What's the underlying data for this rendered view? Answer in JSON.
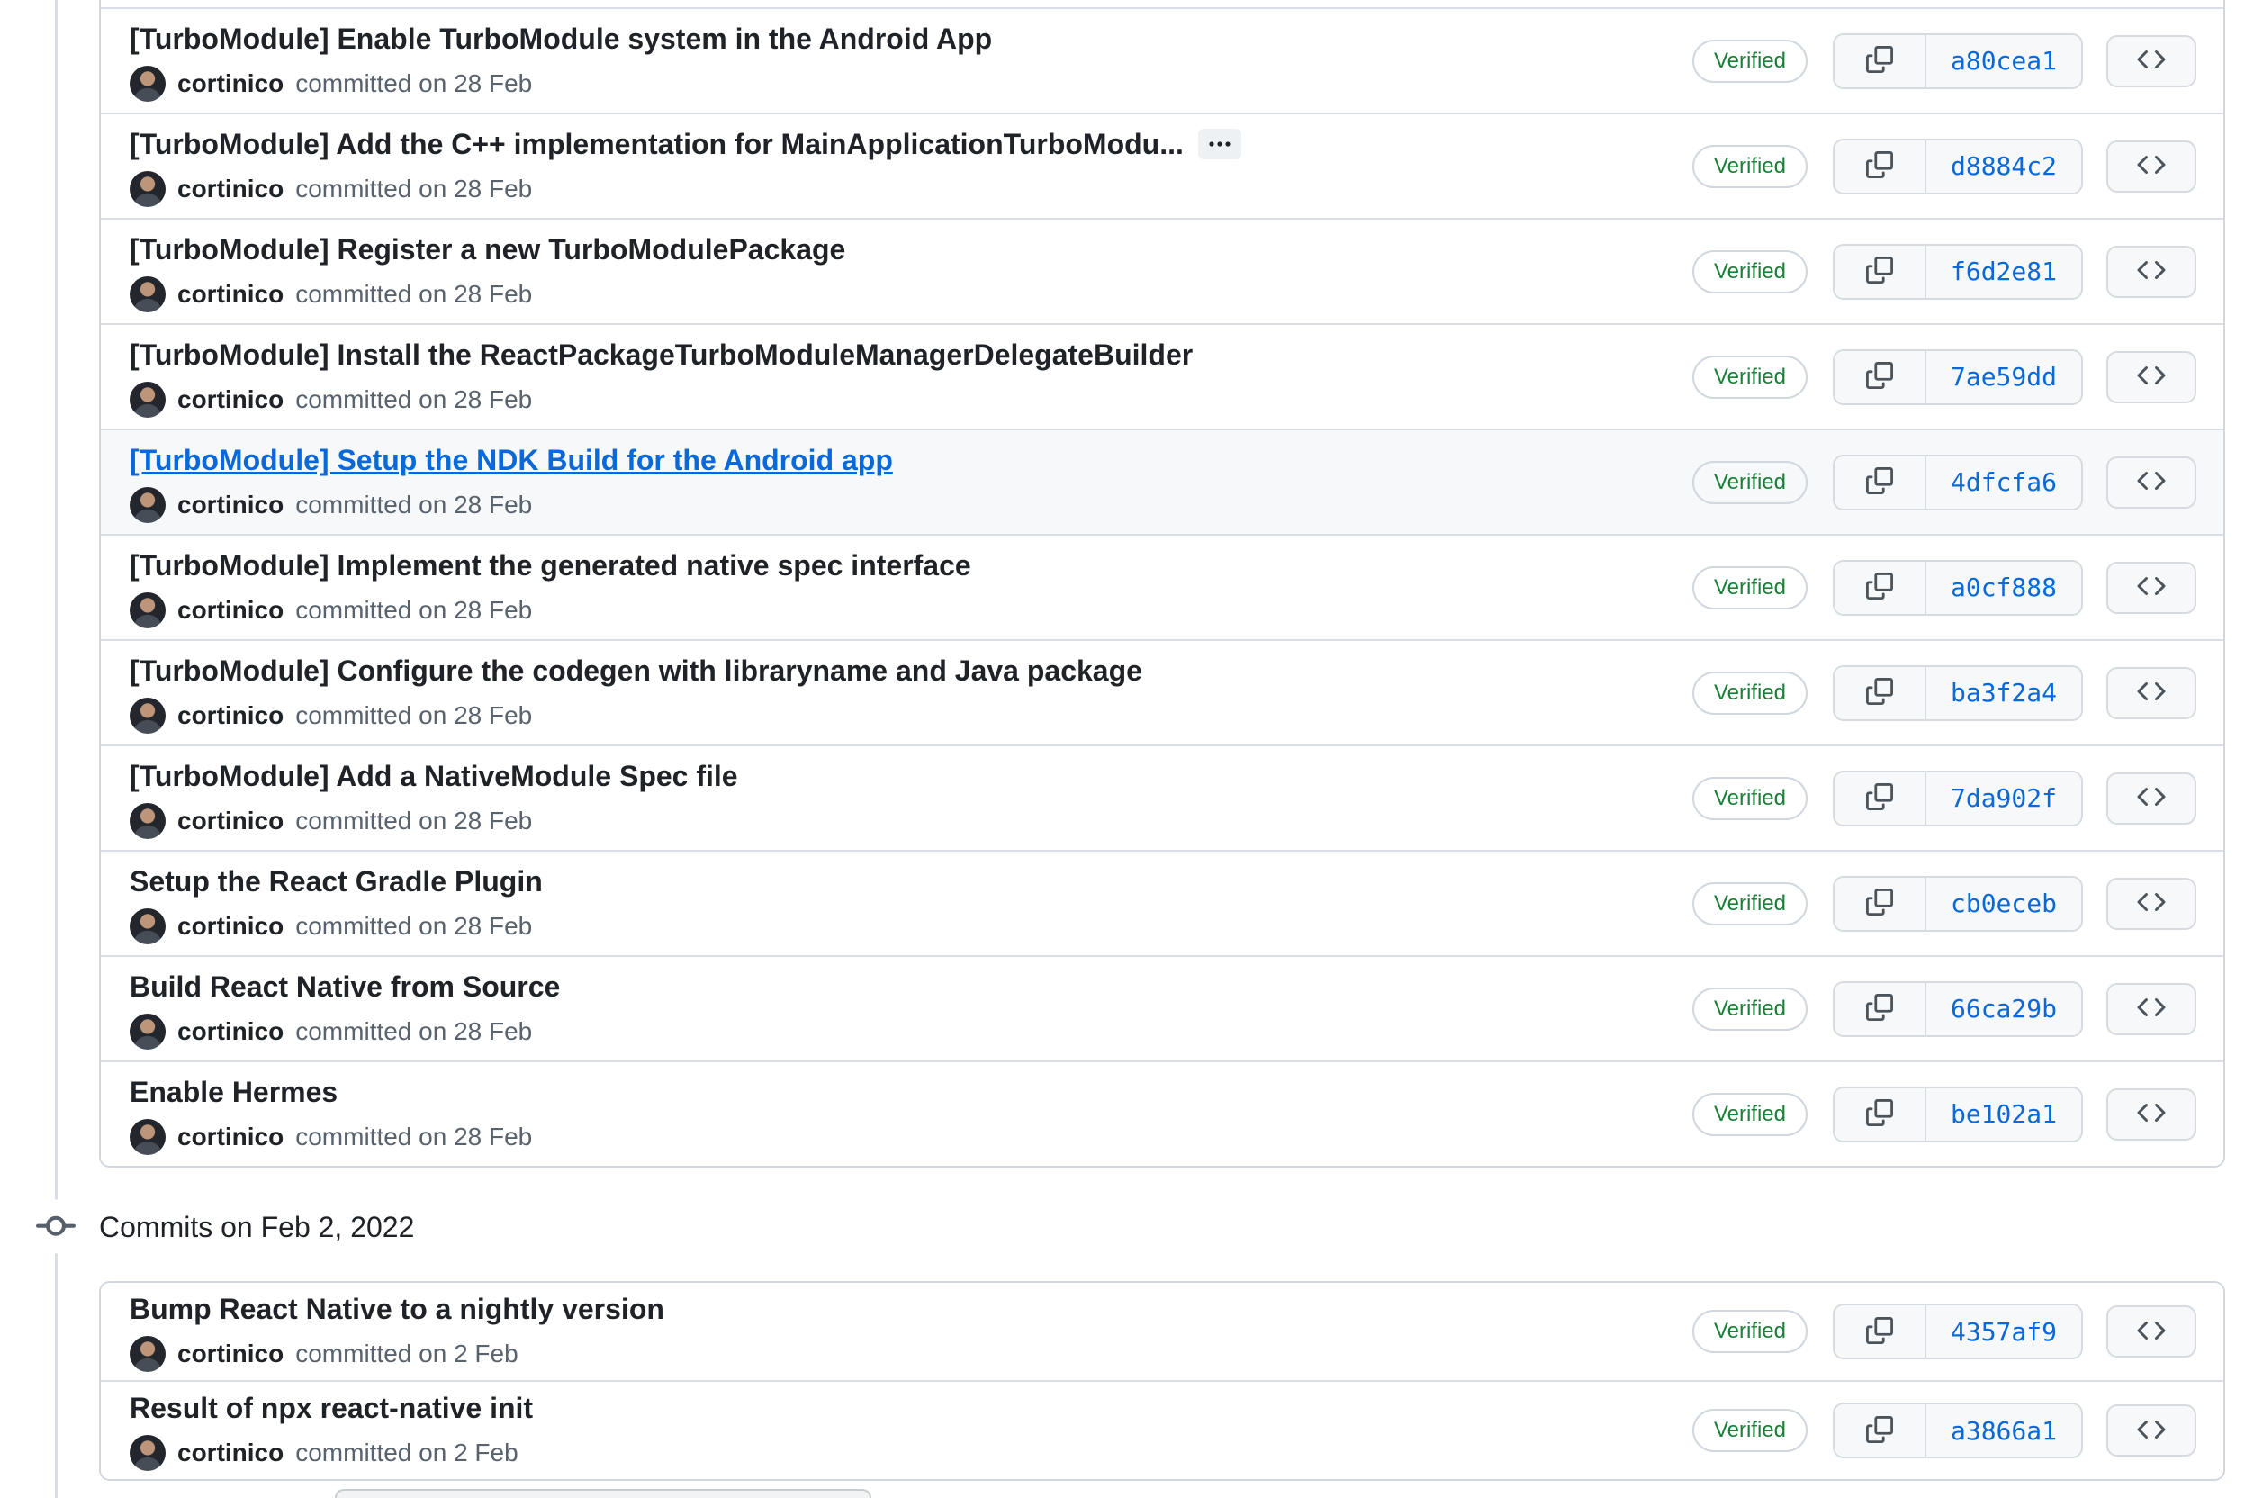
{
  "labels": {
    "verified": "Verified",
    "author": "cortinico"
  },
  "icons": {
    "copy_icon": "⧉",
    "browse_code_icon": "<>",
    "git_commit_icon": "-o-",
    "ellipsis_icon": "⋯"
  },
  "colors": {
    "title_text": "#1f2328",
    "muted_text": "#59636e",
    "link_blue": "#0969da",
    "verified_green": "#1a7f37",
    "container_border": "#d0d7de",
    "row_divider": "#d8dee4",
    "button_bg": "#f6f8fa",
    "hover_row_bg": "#f6f8fa",
    "timeline_line": "#d8dee4"
  },
  "sections": [
    {
      "date_header": null,
      "partial_top_row": true,
      "commits": [
        {
          "title": "[TurboModule] Enable TurboModule system in the Android App",
          "author": "cortinico",
          "committed": "committed on 28 Feb",
          "sha": "a80cea1"
        },
        {
          "title": "[TurboModule] Add the C++ implementation for MainApplicationTurboModu...",
          "expander": true,
          "author": "cortinico",
          "committed": "committed on 28 Feb",
          "sha": "d8884c2"
        },
        {
          "title": "[TurboModule] Register a new TurboModulePackage",
          "author": "cortinico",
          "committed": "committed on 28 Feb",
          "sha": "f6d2e81"
        },
        {
          "title": "[TurboModule] Install the ReactPackageTurboModuleManagerDelegateBuilder",
          "author": "cortinico",
          "committed": "committed on 28 Feb",
          "sha": "7ae59dd"
        },
        {
          "title": "[TurboModule] Setup the NDK Build for the Android app",
          "hovered": true,
          "author": "cortinico",
          "committed": "committed on 28 Feb",
          "sha": "4dfcfa6"
        },
        {
          "title": "[TurboModule] Implement the generated native spec interface",
          "author": "cortinico",
          "committed": "committed on 28 Feb",
          "sha": "a0cf888"
        },
        {
          "title": "[TurboModule] Configure the codegen with libraryname and Java package",
          "author": "cortinico",
          "committed": "committed on 28 Feb",
          "sha": "ba3f2a4"
        },
        {
          "title": "[TurboModule] Add a NativeModule Spec file",
          "author": "cortinico",
          "committed": "committed on 28 Feb",
          "sha": "7da902f"
        },
        {
          "title": "Setup the React Gradle Plugin",
          "author": "cortinico",
          "committed": "committed on 28 Feb",
          "sha": "cb0eceb"
        },
        {
          "title": "Build React Native from Source",
          "author": "cortinico",
          "committed": "committed on 28 Feb",
          "sha": "66ca29b"
        },
        {
          "title": "Enable Hermes",
          "author": "cortinico",
          "committed": "committed on 28 Feb",
          "sha": "be102a1"
        }
      ]
    },
    {
      "date_header": "Commits on Feb 2, 2022",
      "commits": [
        {
          "title": "Bump React Native to a nightly version",
          "author": "cortinico",
          "committed": "committed on 2 Feb",
          "sha": "4357af9"
        },
        {
          "title": "Result of npx react-native init",
          "author": "cortinico",
          "committed": "committed on 2 Feb",
          "sha": "a3866a1"
        }
      ]
    }
  ]
}
